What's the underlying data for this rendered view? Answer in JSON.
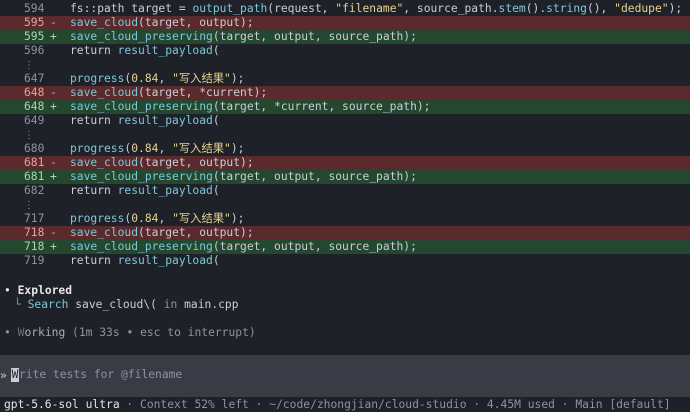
{
  "diff": {
    "lines": [
      {
        "type": "ctx",
        "num": "594",
        "sign": "",
        "parts": [
          {
            "t": "fs::path target = ",
            "c": "kw"
          },
          {
            "t": "output_path",
            "c": "fn"
          },
          {
            "t": "(request, ",
            "c": "kw"
          },
          {
            "t": "\"filename\"",
            "c": "str"
          },
          {
            "t": ", source_path.",
            "c": "kw"
          },
          {
            "t": "stem",
            "c": "fn"
          },
          {
            "t": "().",
            "c": "kw"
          },
          {
            "t": "string",
            "c": "fn"
          },
          {
            "t": "(), ",
            "c": "kw"
          },
          {
            "t": "\"dedupe\"",
            "c": "str"
          },
          {
            "t": ");",
            "c": "kw"
          }
        ]
      },
      {
        "type": "del",
        "num": "595",
        "sign": "-",
        "parts": [
          {
            "t": "save_cloud",
            "c": "fn"
          },
          {
            "t": "(target, output);",
            "c": "kw"
          }
        ]
      },
      {
        "type": "add",
        "num": "595",
        "sign": "+",
        "parts": [
          {
            "t": "save_cloud_preserving",
            "c": "fn"
          },
          {
            "t": "(target, output, source_path);",
            "c": "kw"
          }
        ]
      },
      {
        "type": "ctx",
        "num": "596",
        "sign": "",
        "parts": [
          {
            "t": "return ",
            "c": "kw"
          },
          {
            "t": "result_payload",
            "c": "fn"
          },
          {
            "t": "(",
            "c": "kw"
          }
        ]
      },
      {
        "type": "gap"
      },
      {
        "type": "ctx",
        "num": "647",
        "sign": "",
        "parts": [
          {
            "t": "progress",
            "c": "fn"
          },
          {
            "t": "(",
            "c": "kw"
          },
          {
            "t": "0.84",
            "c": "num"
          },
          {
            "t": ", ",
            "c": "kw"
          },
          {
            "t": "\"写入结果\"",
            "c": "str"
          },
          {
            "t": ");",
            "c": "kw"
          }
        ]
      },
      {
        "type": "del",
        "num": "648",
        "sign": "-",
        "parts": [
          {
            "t": "save_cloud",
            "c": "fn"
          },
          {
            "t": "(target, *current);",
            "c": "kw"
          }
        ]
      },
      {
        "type": "add",
        "num": "648",
        "sign": "+",
        "parts": [
          {
            "t": "save_cloud_preserving",
            "c": "fn"
          },
          {
            "t": "(target, *current, source_path);",
            "c": "kw"
          }
        ]
      },
      {
        "type": "ctx",
        "num": "649",
        "sign": "",
        "parts": [
          {
            "t": "return ",
            "c": "kw"
          },
          {
            "t": "result_payload",
            "c": "fn"
          },
          {
            "t": "(",
            "c": "kw"
          }
        ]
      },
      {
        "type": "gap"
      },
      {
        "type": "ctx",
        "num": "680",
        "sign": "",
        "parts": [
          {
            "t": "progress",
            "c": "fn"
          },
          {
            "t": "(",
            "c": "kw"
          },
          {
            "t": "0.84",
            "c": "num"
          },
          {
            "t": ", ",
            "c": "kw"
          },
          {
            "t": "\"写入结果\"",
            "c": "str"
          },
          {
            "t": ");",
            "c": "kw"
          }
        ]
      },
      {
        "type": "del",
        "num": "681",
        "sign": "-",
        "parts": [
          {
            "t": "save_cloud",
            "c": "fn"
          },
          {
            "t": "(target, output);",
            "c": "kw"
          }
        ]
      },
      {
        "type": "add",
        "num": "681",
        "sign": "+",
        "parts": [
          {
            "t": "save_cloud_preserving",
            "c": "fn"
          },
          {
            "t": "(target, output, source_path);",
            "c": "kw"
          }
        ]
      },
      {
        "type": "ctx",
        "num": "682",
        "sign": "",
        "parts": [
          {
            "t": "return ",
            "c": "kw"
          },
          {
            "t": "result_payload",
            "c": "fn"
          },
          {
            "t": "(",
            "c": "kw"
          }
        ]
      },
      {
        "type": "gap"
      },
      {
        "type": "ctx",
        "num": "717",
        "sign": "",
        "parts": [
          {
            "t": "progress",
            "c": "fn"
          },
          {
            "t": "(",
            "c": "kw"
          },
          {
            "t": "0.84",
            "c": "num"
          },
          {
            "t": ", ",
            "c": "kw"
          },
          {
            "t": "\"写入结果\"",
            "c": "str"
          },
          {
            "t": ");",
            "c": "kw"
          }
        ]
      },
      {
        "type": "del",
        "num": "718",
        "sign": "-",
        "parts": [
          {
            "t": "save_cloud",
            "c": "fn"
          },
          {
            "t": "(target, output);",
            "c": "kw"
          }
        ]
      },
      {
        "type": "add",
        "num": "718",
        "sign": "+",
        "parts": [
          {
            "t": "save_cloud_preserving",
            "c": "fn"
          },
          {
            "t": "(target, output, source_path);",
            "c": "kw"
          }
        ]
      },
      {
        "type": "ctx",
        "num": "719",
        "sign": "",
        "parts": [
          {
            "t": "return ",
            "c": "kw"
          },
          {
            "t": "result_payload",
            "c": "fn"
          },
          {
            "t": "(",
            "c": "kw"
          }
        ]
      }
    ],
    "gap_glyph": "⋮"
  },
  "explored": {
    "bullet": "•",
    "title": "Explored",
    "tree": "└",
    "verb": "Search",
    "query": "save_cloud\\(",
    "in_word": "in",
    "file": "main.cpp"
  },
  "status_working": {
    "bullet": "•",
    "w1": "W",
    "w2": "orking",
    "detail": " (1m 33s • esc to interrupt)"
  },
  "composer": {
    "chevron": "»",
    "cursor_char": "W",
    "placeholder": "rite tests for @filename"
  },
  "statusbar": {
    "model": "gpt-5.6-sol ultra",
    "sep": " · ",
    "context": "Context 52% left",
    "path": "~/code/zhongjian/cloud-studio",
    "tokens": "4.45M used",
    "branch": "Main [default]"
  },
  "colors": {
    "bg": "#1f2129",
    "del_bg": "#5b2a2c",
    "add_bg": "#24472f",
    "fn": "#7ec7d9",
    "str": "#e6d38f"
  }
}
